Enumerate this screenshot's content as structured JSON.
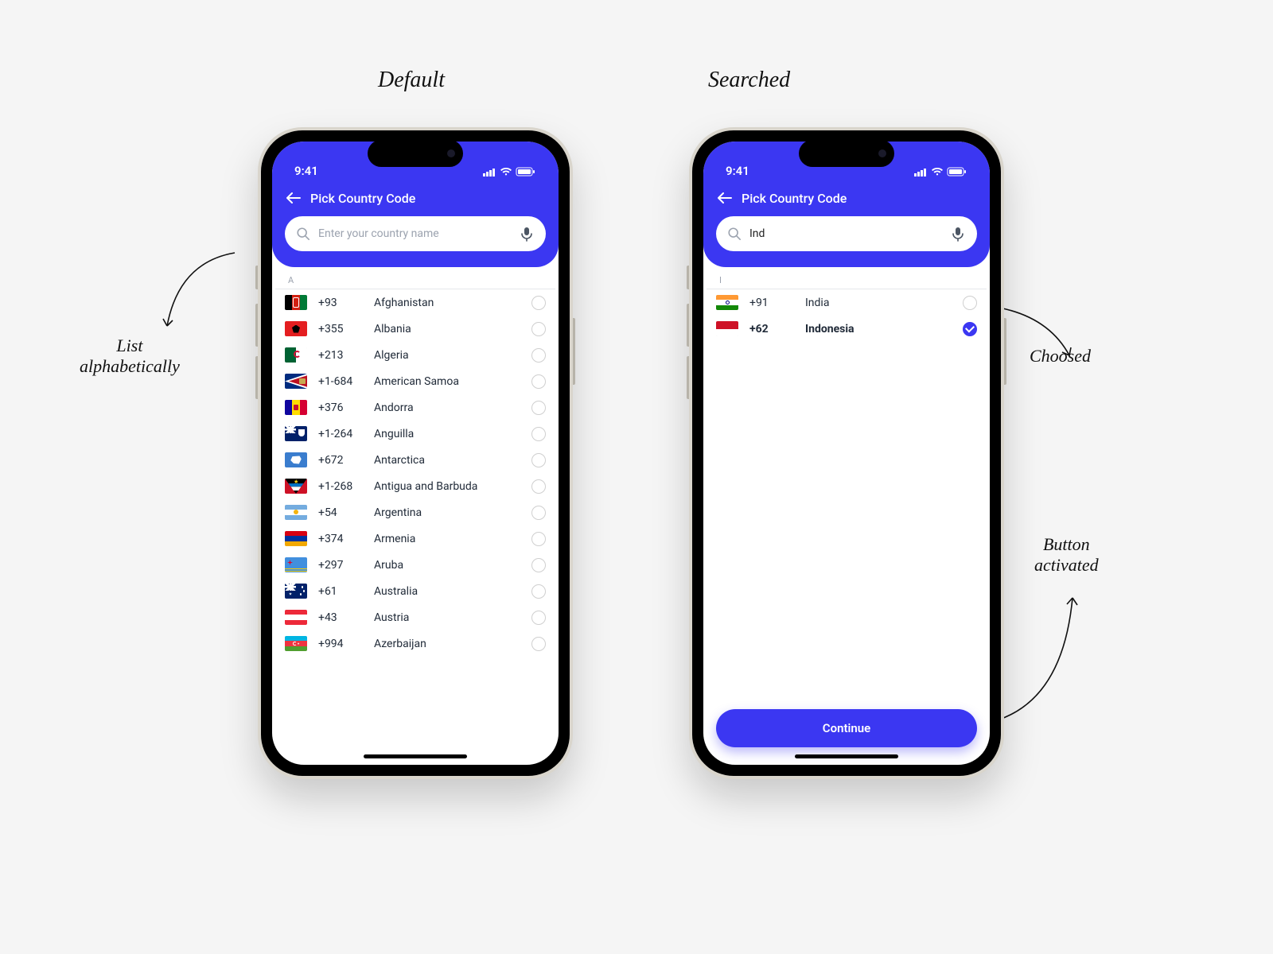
{
  "labels": {
    "default": "Default",
    "searched": "Searched",
    "alpha": "List\nalphabetically",
    "choosed": "Choosed",
    "button_activated": "Button\nactivated"
  },
  "status": {
    "time": "9:41"
  },
  "header": {
    "title": "Pick Country Code"
  },
  "search": {
    "placeholder": "Enter your country name",
    "value_searched": "Ind"
  },
  "default": {
    "section": "A",
    "countries": [
      {
        "code": "+93",
        "name": "Afghanistan",
        "flag": "af"
      },
      {
        "code": "+355",
        "name": "Albania",
        "flag": "al"
      },
      {
        "code": "+213",
        "name": "Algeria",
        "flag": "dz"
      },
      {
        "code": "+1-684",
        "name": "American Samoa",
        "flag": "as"
      },
      {
        "code": "+376",
        "name": "Andorra",
        "flag": "ad"
      },
      {
        "code": "+1-264",
        "name": "Anguilla",
        "flag": "ai"
      },
      {
        "code": "+672",
        "name": "Antarctica",
        "flag": "aq"
      },
      {
        "code": "+1-268",
        "name": "Antigua and Barbuda",
        "flag": "ag"
      },
      {
        "code": "+54",
        "name": "Argentina",
        "flag": "ar"
      },
      {
        "code": "+374",
        "name": "Armenia",
        "flag": "am"
      },
      {
        "code": "+297",
        "name": "Aruba",
        "flag": "aw"
      },
      {
        "code": "+61",
        "name": "Australia",
        "flag": "au"
      },
      {
        "code": "+43",
        "name": "Austria",
        "flag": "at"
      },
      {
        "code": "+994",
        "name": "Azerbaijan",
        "flag": "az"
      }
    ]
  },
  "searched": {
    "section": "I",
    "countries": [
      {
        "code": "+91",
        "name": "India",
        "flag": "in",
        "selected": false
      },
      {
        "code": "+62",
        "name": "Indonesia",
        "flag": "id",
        "selected": true
      }
    ]
  },
  "cta": {
    "continue": "Continue"
  }
}
